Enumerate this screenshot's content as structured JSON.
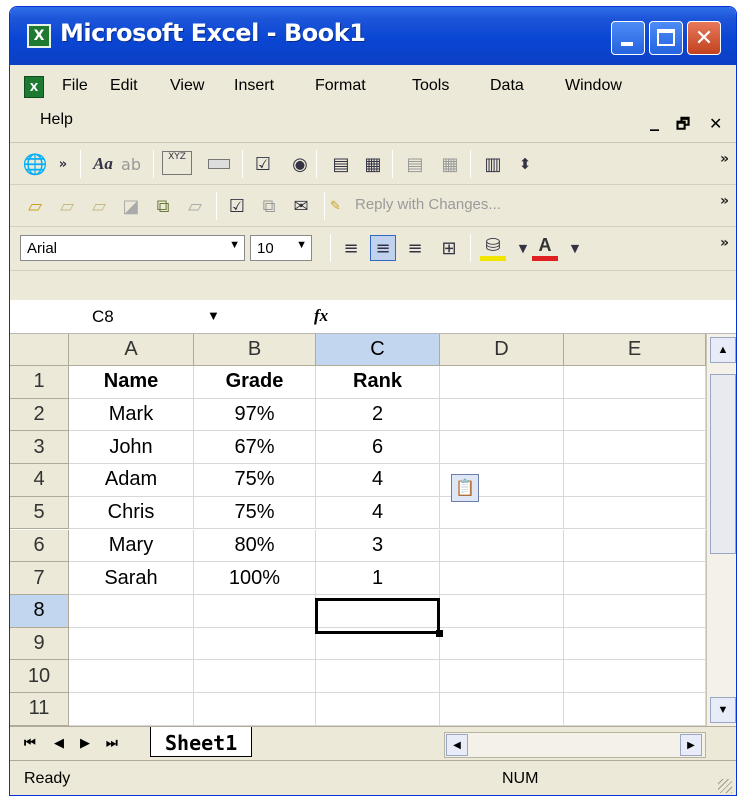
{
  "window": {
    "title": "Microsoft Excel - Book1",
    "app_icon": "excel-icon",
    "buttons": [
      "minimize",
      "maximize",
      "close"
    ],
    "close_glyph": "✕"
  },
  "menubar": {
    "items": [
      "File",
      "Edit",
      "View",
      "Insert",
      "Format",
      "Tools",
      "Data",
      "Window",
      "Help"
    ],
    "right_controls": [
      "_",
      "🗗",
      "✕"
    ]
  },
  "toolbar_forms": {
    "icons": [
      "globe-icon",
      "aa-icon",
      "textbox-icon",
      "groupbox-icon",
      "button-icon",
      "checkbox-icon",
      "radio-icon",
      "listbox-icon",
      "combobox-icon",
      "combo-list-icon",
      "combo-dropdown-icon",
      "scrollbar-icon",
      "spinner-icon"
    ],
    "text_labels": {
      "aa": "Aa",
      "ab": "ab",
      "xyz": "XYZ"
    }
  },
  "toolbar_reviewing": {
    "reply_label": "Reply with Changes..."
  },
  "toolbar_format": {
    "font": "Arial",
    "size": "10",
    "icons": [
      "align-left-icon",
      "align-center-icon",
      "align-right-icon",
      "merge-center-icon",
      "fill-color-icon",
      "font-color-icon"
    ],
    "fill_color": "#f2e600",
    "font_color": "#e02020"
  },
  "formula_bar": {
    "name_box": "C8",
    "fx": "fx",
    "content": ""
  },
  "grid": {
    "columns": [
      "A",
      "B",
      "C",
      "D",
      "E"
    ],
    "row_numbers": [
      "1",
      "2",
      "3",
      "4",
      "5",
      "6",
      "7",
      "8",
      "9",
      "10",
      "11"
    ],
    "selected_column": "C",
    "selected_row": "8",
    "rows": [
      [
        "Name",
        "Grade",
        "Rank",
        "",
        ""
      ],
      [
        "Mark",
        "97%",
        "2",
        "",
        ""
      ],
      [
        "John",
        "67%",
        "6",
        "",
        ""
      ],
      [
        "Adam",
        "75%",
        "4",
        "",
        ""
      ],
      [
        "Chris",
        "75%",
        "4",
        "",
        ""
      ],
      [
        "Mary",
        "80%",
        "3",
        "",
        ""
      ],
      [
        "Sarah",
        "100%",
        "1",
        "",
        ""
      ],
      [
        "",
        "",
        "",
        "",
        ""
      ],
      [
        "",
        "",
        "",
        "",
        ""
      ],
      [
        "",
        "",
        "",
        "",
        ""
      ],
      [
        "",
        "",
        "",
        "",
        ""
      ]
    ],
    "active_cell": "C8",
    "paste_options_icon": "paste-options-icon"
  },
  "sheet_tabs": {
    "tabs": [
      "Sheet1"
    ],
    "nav_glyphs": [
      "⏮",
      "◀",
      "▶",
      "⏭"
    ]
  },
  "status": {
    "ready": "Ready",
    "num": "NUM"
  }
}
